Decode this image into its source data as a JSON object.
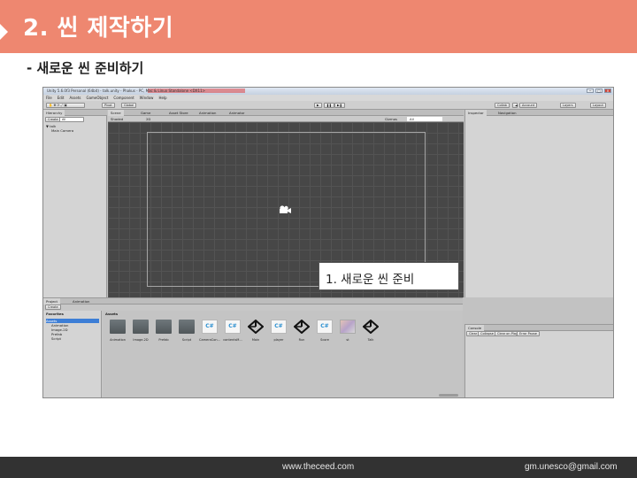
{
  "slide": {
    "title": "2. 씬 제작하기",
    "subtitle": "- 새로운 씬 준비하기",
    "accent_color": "#ee8770"
  },
  "unity": {
    "window_title": "Unity 5.6.0f3 Personal (64bit) - talk.unity - Phakus - PC, Mac & Linux Standalone <DX11>",
    "window_buttons": [
      "−",
      "□",
      "×"
    ],
    "menu": [
      "File",
      "Edit",
      "Assets",
      "GameObject",
      "Component",
      "Window",
      "Help"
    ],
    "toolbar": {
      "pivot": "Pivot",
      "global": "Global",
      "play_icons": [
        "▶",
        "❚❚",
        "▶❚"
      ],
      "collab": "Collab",
      "account": "Account",
      "layers": "Layers",
      "layout": "Layout"
    },
    "hierarchy": {
      "tab": "Hierarchy",
      "create": "Create",
      "search_placeholder": "All",
      "scene_name": "talk",
      "items": [
        "Main Camera"
      ]
    },
    "scene_tabs": [
      "Scene",
      "Game",
      "Asset Store",
      "Animation",
      "Animator"
    ],
    "scene_toolbar": {
      "shaded": "Shaded",
      "mode_2d": "2D",
      "gizmos": "Gizmos",
      "search": "All"
    },
    "callout": "1. 새로운 씬 준비",
    "inspector_tabs": [
      "Inspector",
      "Navigation"
    ],
    "project": {
      "tabs": [
        "Project",
        "Animation"
      ],
      "create": "Create",
      "favorites": "Favorites",
      "breadcrumb": "Assets",
      "tree": [
        "Assets",
        "Animation",
        "Image-2D",
        "Prefab",
        "Script"
      ],
      "assets": [
        {
          "name": "Animation",
          "kind": "folder"
        },
        {
          "name": "Image-2D",
          "kind": "folder"
        },
        {
          "name": "Prefab",
          "kind": "folder"
        },
        {
          "name": "Script",
          "kind": "folder"
        },
        {
          "name": "CameraCon...",
          "kind": "cs"
        },
        {
          "name": "contentsM...",
          "kind": "cs"
        },
        {
          "name": "Main",
          "kind": "unity"
        },
        {
          "name": "player",
          "kind": "cs"
        },
        {
          "name": "Run",
          "kind": "unity"
        },
        {
          "name": "Score",
          "kind": "cs"
        },
        {
          "name": "st",
          "kind": "image"
        },
        {
          "name": "Talk",
          "kind": "unity"
        }
      ]
    },
    "console": {
      "tab": "Console",
      "buttons": [
        "Clear",
        "Collapse",
        "Clear on Play",
        "Error Pause"
      ]
    }
  },
  "footer": {
    "website": "www.theceed.com",
    "email": "gm.unesco@gmail.com"
  }
}
